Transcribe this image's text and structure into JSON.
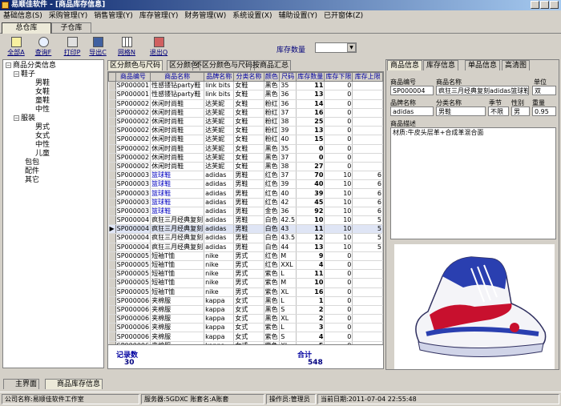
{
  "window": {
    "title": "易顺佳软件 - [商品库存信息]"
  },
  "menu": [
    "基础信息(S)",
    "采购管理(Y)",
    "销售管理(Y)",
    "库存管理(Y)",
    "财务管理(W)",
    "系统设置(X)",
    "辅助设置(Y)",
    "已开窗体(Z)"
  ],
  "warehouse_tabs": [
    "总仓库",
    "子仓库"
  ],
  "toolbar": [
    {
      "label": "全部A",
      "icon": "show-all-icon"
    },
    {
      "label": "查询F",
      "icon": "search-icon"
    },
    {
      "label": "打印P",
      "icon": "print-icon"
    },
    {
      "label": "导出C",
      "icon": "export-icon"
    },
    {
      "label": "网格N",
      "icon": "grid-icon"
    },
    {
      "label": "退出Q",
      "icon": "exit-icon"
    }
  ],
  "stock_filter": {
    "label": "库存数量",
    "value": ""
  },
  "tree": {
    "root": "商品分类信息",
    "nodes": [
      {
        "label": "鞋子",
        "level": 1,
        "expanded": true
      },
      {
        "label": "男鞋",
        "level": 2
      },
      {
        "label": "女鞋",
        "level": 2
      },
      {
        "label": "童鞋",
        "level": 2
      },
      {
        "label": "中性",
        "level": 2
      },
      {
        "label": "服装",
        "level": 1,
        "expanded": true
      },
      {
        "label": "男式",
        "level": 2
      },
      {
        "label": "女式",
        "level": 2
      },
      {
        "label": "中性",
        "level": 2
      },
      {
        "label": "儿童",
        "level": 2
      },
      {
        "label": "包包",
        "level": 1
      },
      {
        "label": "配件",
        "level": 1
      },
      {
        "label": "其它",
        "level": 1
      }
    ]
  },
  "center_tabs": [
    "区分颜色与尺码",
    "区分颜色",
    "不区分颜色与尺码",
    "按商品汇总"
  ],
  "grid": {
    "columns": [
      "商品编号",
      "商品名称",
      "品牌名称",
      "分类名称",
      "颜色",
      "尺码",
      "库存数量",
      "库存下限",
      "库存上限"
    ],
    "rows": [
      [
        "SP000001",
        "性感镂钻party鞋",
        "link bits",
        "女鞋",
        "黑色",
        "35",
        "11",
        "0",
        ""
      ],
      [
        "SP000001",
        "性感镂钻party鞋",
        "link bits",
        "女鞋",
        "黑色",
        "36",
        "13",
        "0",
        ""
      ],
      [
        "SP000002",
        "休闲时尚鞋",
        "达芙妮",
        "女鞋",
        "粉红",
        "36",
        "14",
        "0",
        ""
      ],
      [
        "SP000002",
        "休闲时尚鞋",
        "达芙妮",
        "女鞋",
        "粉红",
        "37",
        "16",
        "0",
        ""
      ],
      [
        "SP000002",
        "休闲时尚鞋",
        "达芙妮",
        "女鞋",
        "粉红",
        "38",
        "25",
        "0",
        ""
      ],
      [
        "SP000002",
        "休闲时尚鞋",
        "达芙妮",
        "女鞋",
        "粉红",
        "39",
        "13",
        "0",
        ""
      ],
      [
        "SP000002",
        "休闲时尚鞋",
        "达芙妮",
        "女鞋",
        "粉红",
        "40",
        "15",
        "0",
        ""
      ],
      [
        "SP000002",
        "休闲时尚鞋",
        "达芙妮",
        "女鞋",
        "黑色",
        "35",
        "0",
        "0",
        ""
      ],
      [
        "SP000002",
        "休闲时尚鞋",
        "达芙妮",
        "女鞋",
        "黑色",
        "37",
        "0",
        "0",
        ""
      ],
      [
        "SP000002",
        "休闲时尚鞋",
        "达芙妮",
        "女鞋",
        "黑色",
        "38",
        "27",
        "0",
        ""
      ],
      [
        "SP000003",
        "篮球鞋",
        "adidas",
        "男鞋",
        "红色",
        "37",
        "70",
        "10",
        "6"
      ],
      [
        "SP000003",
        "篮球鞋",
        "adidas",
        "男鞋",
        "红色",
        "39",
        "40",
        "10",
        "6"
      ],
      [
        "SP000003",
        "篮球鞋",
        "adidas",
        "男鞋",
        "红色",
        "40",
        "39",
        "10",
        "6"
      ],
      [
        "SP000003",
        "篮球鞋",
        "adidas",
        "男鞋",
        "红色",
        "42",
        "45",
        "10",
        "6"
      ],
      [
        "SP000003",
        "篮球鞋",
        "adidas",
        "男鞋",
        "金色",
        "36",
        "92",
        "10",
        "6"
      ],
      [
        "SP000004",
        "疯狂三月经典复刻",
        "adidas",
        "男鞋",
        "白色",
        "42.5",
        "10",
        "10",
        "5"
      ],
      [
        "SP000004",
        "疯狂三月经典复刻",
        "adidas",
        "男鞋",
        "白色",
        "43",
        "11",
        "10",
        "5"
      ],
      [
        "SP000004",
        "疯狂三月经典复刻",
        "adidas",
        "男鞋",
        "白色",
        "43.5",
        "12",
        "10",
        "5"
      ],
      [
        "SP000004",
        "疯狂三月经典复刻",
        "adidas",
        "男鞋",
        "白色",
        "44",
        "13",
        "10",
        "5"
      ],
      [
        "SP000005",
        "短袖T恤",
        "nike",
        "男式",
        "红色",
        "M",
        "9",
        "0",
        ""
      ],
      [
        "SP000005",
        "短袖T恤",
        "nike",
        "男式",
        "红色",
        "XXL",
        "4",
        "0",
        ""
      ],
      [
        "SP000005",
        "短袖T恤",
        "nike",
        "男式",
        "紫色",
        "L",
        "11",
        "0",
        ""
      ],
      [
        "SP000005",
        "短袖T恤",
        "nike",
        "男式",
        "紫色",
        "M",
        "10",
        "0",
        ""
      ],
      [
        "SP000005",
        "短袖T恤",
        "nike",
        "男式",
        "紫色",
        "XL",
        "16",
        "0",
        ""
      ],
      [
        "SP000006",
        "夹棉服",
        "kappa",
        "女式",
        "黑色",
        "L",
        "1",
        "0",
        ""
      ],
      [
        "SP000006",
        "夹棉服",
        "kappa",
        "女式",
        "黑色",
        "S",
        "2",
        "0",
        ""
      ],
      [
        "SP000006",
        "夹棉服",
        "kappa",
        "女式",
        "黑色",
        "XL",
        "2",
        "0",
        ""
      ],
      [
        "SP000006",
        "夹棉服",
        "kappa",
        "女式",
        "紫色",
        "L",
        "3",
        "0",
        ""
      ],
      [
        "SP000006",
        "夹棉服",
        "kappa",
        "女式",
        "紫色",
        "S",
        "4",
        "0",
        ""
      ],
      [
        "SP000006",
        "夹棉服",
        "kappa",
        "女式",
        "紫色",
        "XL",
        "5",
        "0",
        ""
      ]
    ],
    "selected_row": 16,
    "footer": {
      "record_label": "记录数",
      "record_count": "30",
      "total_label": "合计",
      "total_value": "548"
    }
  },
  "right_tabs": [
    "商品信息",
    "库存信息",
    "单品信息",
    "高清图"
  ],
  "product_info": {
    "code_label": "商品编号",
    "code": "SP000004",
    "name_label": "商品名称",
    "name": "疯狂三月经典复刻adidas篮球鞋",
    "unit_label": "单位",
    "unit": "双",
    "brand_label": "品牌名称",
    "brand": "adidas",
    "category_label": "分类名称",
    "category": "男鞋",
    "season_label": "季节",
    "season": "不限",
    "gender_label": "性别",
    "gender": "男",
    "weight_label": "重量",
    "weight": "0.95",
    "desc_label": "商品描述",
    "desc": "材质:牛皮头层革+合成革混合面"
  },
  "bottom_tabs": [
    "主界面",
    "商品库存信息"
  ],
  "status": {
    "company": "公司名称:易顺佳软件工作室",
    "server": "服务器:5GDXC",
    "account": "账套名:A账套",
    "operator": "操作员:管理员",
    "date": "当前日期:2011-07-04 22:55:48"
  },
  "colors": {
    "titlebar": "#0a246a",
    "window": "#d4d0c8",
    "header_text": "#0000a0",
    "link_blue": "#00007a"
  }
}
